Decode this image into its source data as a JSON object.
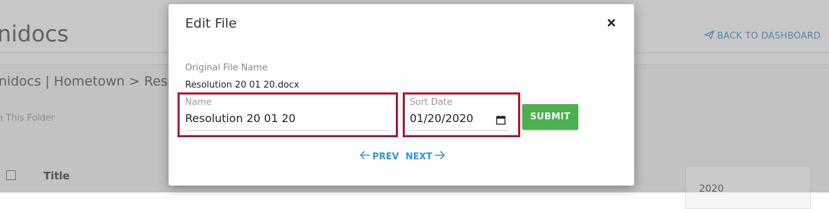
{
  "background": {
    "app_title": "nidocs",
    "back_link": "BACK TO DASHBOARD",
    "breadcrumb": "nidocs | Hometown > Reso",
    "search_placeholder": "n This Folder",
    "column_title": "Title",
    "year": "2020"
  },
  "modal": {
    "title": "Edit File",
    "original_file_name_label": "Original File Name",
    "original_file_name": "Resolution 20 01 20.docx",
    "name_label": "Name",
    "name_value": "Resolution 20 01 20",
    "sort_date_label": "Sort Date",
    "sort_date_value": "01/20/2020",
    "submit_label": "SUBMIT",
    "prev_label": "PREV",
    "next_label": "NEXT"
  },
  "colors": {
    "submit": "#4caf50",
    "highlight": "#b0132a",
    "link": "#2f96d8"
  },
  "icons": [
    "close-icon",
    "calendar-icon",
    "arrow-left-icon",
    "arrow-right-icon",
    "send-icon"
  ]
}
